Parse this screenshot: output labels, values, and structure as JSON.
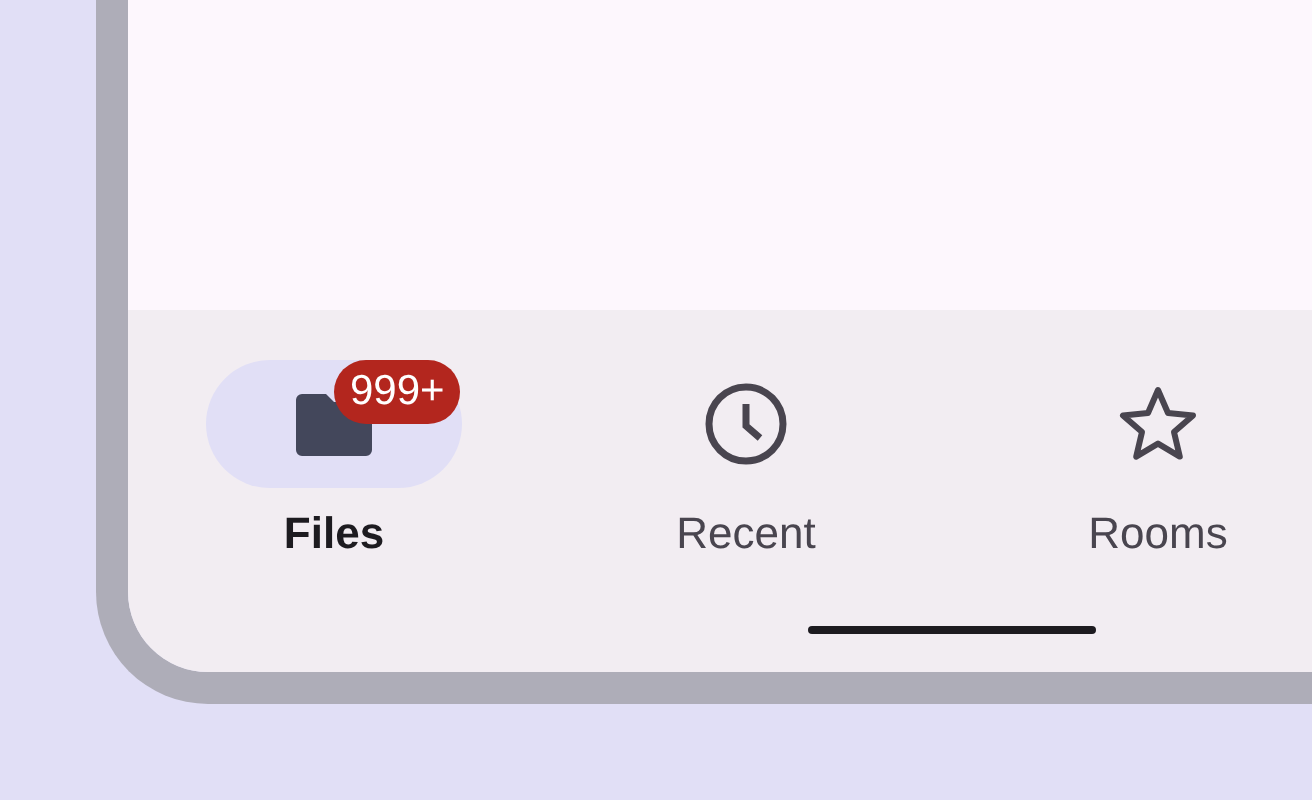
{
  "navigation_bar": {
    "items": [
      {
        "kind": "folder",
        "label": "Files",
        "selected": true,
        "badge": "999+"
      },
      {
        "kind": "clock",
        "label": "Recent",
        "selected": false
      },
      {
        "kind": "star",
        "label": "Rooms",
        "selected": false
      }
    ]
  }
}
